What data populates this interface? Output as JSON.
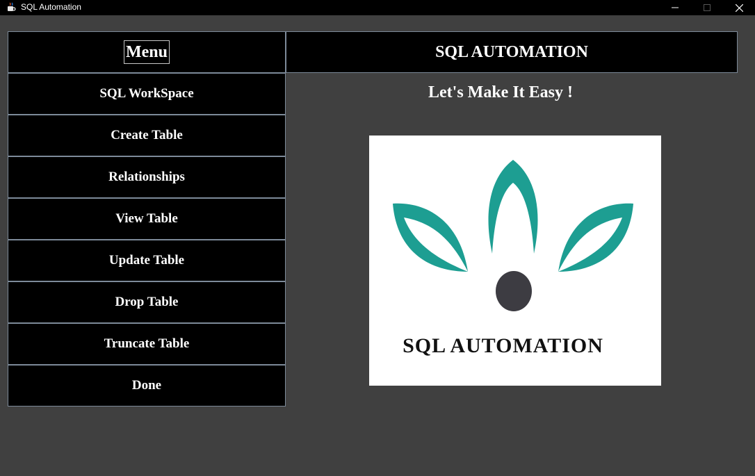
{
  "window": {
    "title": "SQL Automation",
    "app_icon": "java-cup-icon",
    "controls": [
      "minimize-icon",
      "maximize-icon",
      "close-icon"
    ]
  },
  "menu": {
    "header": "Menu",
    "items": [
      {
        "label": "SQL WorkSpace"
      },
      {
        "label": "Create Table"
      },
      {
        "label": "Relationships"
      },
      {
        "label": "View Table"
      },
      {
        "label": "Update Table"
      },
      {
        "label": "Drop Table"
      },
      {
        "label": "Truncate Table"
      },
      {
        "label": "Done"
      }
    ]
  },
  "main": {
    "header": "SQL AUTOMATION",
    "tagline": "Let's Make It Easy !",
    "logo": {
      "text": "SQL AUTOMATION",
      "leaf_color": "#1d9e92",
      "dot_color": "#3d3c42"
    }
  },
  "colors": {
    "background": "#404040",
    "panel": "#000000",
    "border": "#7d8a99",
    "text": "#ffffff"
  }
}
